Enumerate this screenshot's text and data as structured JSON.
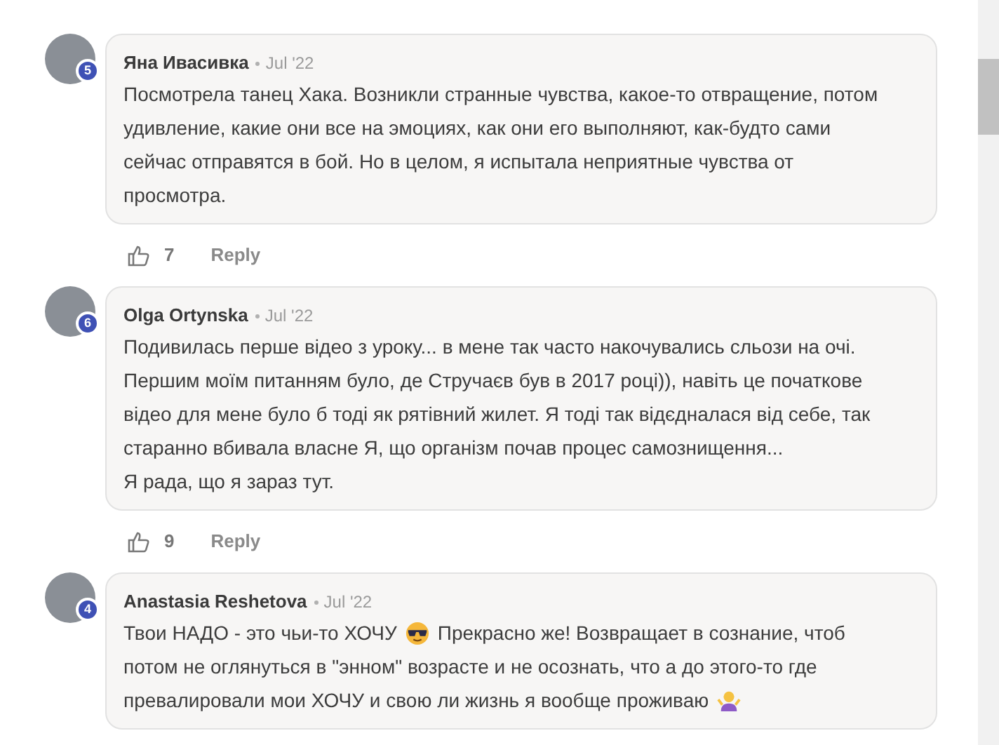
{
  "comments": [
    {
      "author": "Яна Ивасивка",
      "badge": "5",
      "date": "Jul '22",
      "lines": [
        [
          {
            "kind": "text",
            "text": "Посмотрела танец Хака. Возникли странные чувства, какое-то отвращение, потом"
          }
        ],
        [
          {
            "kind": "text",
            "text": "удивление, какие они все на эмоциях, как они его выполняют, как-будто сами"
          }
        ],
        [
          {
            "kind": "text",
            "text": "сейчас отправятся в бой. Но в целом, я испытала неприятные чувства от"
          }
        ],
        [
          {
            "kind": "text",
            "text": "просмотра."
          }
        ]
      ],
      "likes": "7",
      "reply": "Reply"
    },
    {
      "author": "Olga Ortynska",
      "badge": "6",
      "date": "Jul '22",
      "lines": [
        [
          {
            "kind": "text",
            "text": "Подивилась перше відео з уроку... в мене так часто накочувались сльози на очі."
          }
        ],
        [
          {
            "kind": "text",
            "text": "Першим моїм питанням було, де Стручаєв був в 2017 році)), навіть це початкове"
          }
        ],
        [
          {
            "kind": "text",
            "text": "відео для мене було б тоді як рятівний жилет. Я тоді так відєдналася від себе, так"
          }
        ],
        [
          {
            "kind": "text",
            "text": "старанно вбивала власне Я, що організм почав процес самознищення..."
          }
        ],
        [
          {
            "kind": "text",
            "text": "Я рада, що я зараз тут."
          }
        ]
      ],
      "likes": "9",
      "reply": "Reply"
    },
    {
      "author": "Anastasia Reshetova",
      "badge": "4",
      "date": "Jul '22",
      "lines": [
        [
          {
            "kind": "text",
            "text": "Твои НАДО - это чьи-то ХОЧУ"
          },
          {
            "kind": "sunglasses"
          },
          {
            "kind": "text",
            "text": "Прекрасно же! Возвращает в сознание, чтоб"
          }
        ],
        [
          {
            "kind": "text",
            "text": "потом не оглянуться в \"энном\" возрасте и не осознать, что а до этого-то где"
          }
        ],
        [
          {
            "kind": "text",
            "text": "превалировали мои ХОЧУ и свою ли жизнь я вообще проживаю"
          },
          {
            "kind": "shrug"
          }
        ]
      ]
    }
  ]
}
